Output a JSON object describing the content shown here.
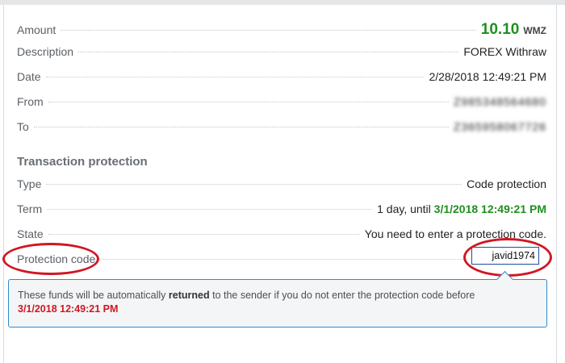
{
  "details": {
    "amount": {
      "label": "Amount",
      "value": "10.10",
      "currency": "WMZ"
    },
    "description": {
      "label": "Description",
      "value": "FOREX Withraw"
    },
    "date": {
      "label": "Date",
      "value": "2/28/2018 12:49:21 PM"
    },
    "from": {
      "label": "From",
      "value": "Z985348564680"
    },
    "to": {
      "label": "To",
      "value": "Z365958067726"
    }
  },
  "protection": {
    "title": "Transaction protection",
    "type": {
      "label": "Type",
      "value": "Code protection"
    },
    "term": {
      "label": "Term",
      "prefix": "1 day, until",
      "until": "3/1/2018 12:49:21 PM"
    },
    "state": {
      "label": "State",
      "value": "You need to enter a protection code."
    },
    "code": {
      "label": "Protection code",
      "value": "javid1974"
    }
  },
  "notice": {
    "part1": "These funds will be automatically",
    "emphasis": "returned",
    "part2": "to the sender if you do not enter the protection code before",
    "deadline": "3/1/2018 12:49:21 PM"
  },
  "colors": {
    "amount_green": "#1f8f1f",
    "annotation_red": "#d01722",
    "notice_border": "#2a8bd0"
  }
}
